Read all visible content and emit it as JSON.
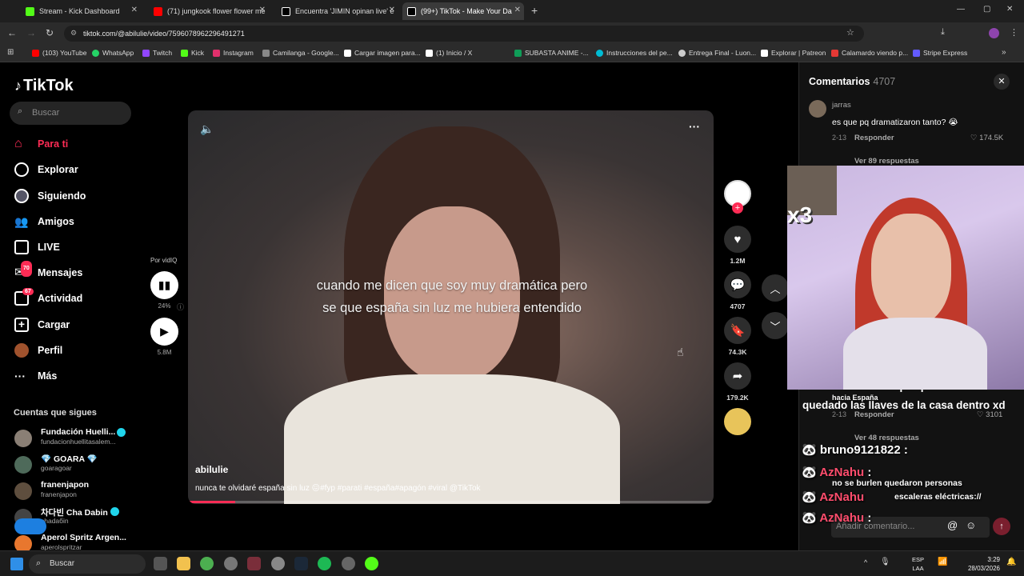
{
  "browser": {
    "tabs": [
      {
        "label": "Stream - Kick Dashboard",
        "color": "#53fc18"
      },
      {
        "label": "(71) jungkook flower flower me",
        "color": "#ff0000"
      },
      {
        "label": "Encuentra 'JIMIN opinan live' e",
        "color": "#ffffff"
      },
      {
        "label": "(99+) TikTok - Make Your Da",
        "color": "#ffffff"
      }
    ],
    "url": "tiktok.com/@abilulie/video/7596078962296491271",
    "bookmarks": [
      {
        "label": "(103) YouTube",
        "color": "#ff0000"
      },
      {
        "label": "WhatsApp",
        "color": "#25d366"
      },
      {
        "label": "Twitch",
        "color": "#9146ff"
      },
      {
        "label": "Kick",
        "color": "#53fc18"
      },
      {
        "label": "Instagram",
        "color": "#e1306c"
      },
      {
        "label": "Camilanga - Google...",
        "color": "#888888"
      },
      {
        "label": "Cargar imagen para...",
        "color": "#ffffff"
      },
      {
        "label": "(1) Inicio / X",
        "color": "#ffffff"
      },
      {
        "label": "SUBASTA ANIME -...",
        "color": "#0f9d58"
      },
      {
        "label": "Instrucciones del pe...",
        "color": "#00bcd4"
      },
      {
        "label": "Entrega Final - Luon...",
        "color": "#cccccc"
      },
      {
        "label": "Explorar | Patreon",
        "color": "#ffffff"
      },
      {
        "label": "Calamardo viendo p...",
        "color": "#e53935"
      },
      {
        "label": "Stripe Express",
        "color": "#635bff"
      }
    ]
  },
  "tiktok": {
    "logo": "TikTok",
    "search_placeholder": "Buscar",
    "nav": [
      {
        "label": "Para ti",
        "active": true
      },
      {
        "label": "Explorar"
      },
      {
        "label": "Siguiendo"
      },
      {
        "label": "Amigos"
      },
      {
        "label": "LIVE"
      },
      {
        "label": "Mensajes",
        "badge": "70"
      },
      {
        "label": "Actividad",
        "badge": "67"
      },
      {
        "label": "Cargar"
      },
      {
        "label": "Perfil"
      },
      {
        "label": "Más"
      }
    ],
    "following_heading": "Cuentas que sigues",
    "following": [
      {
        "name": "Fundación Huelli...",
        "handle": "fundacionhuellitasalem..."
      },
      {
        "name": "💎 GOARA 💎",
        "handle": "goaragoar"
      },
      {
        "name": "franenjapon",
        "handle": "franenjapon"
      },
      {
        "name": "차다빈 Cha Dabin",
        "handle": "chadaбin"
      },
      {
        "name": "Aperol Spritz Argen...",
        "handle": "aperolspritzar"
      }
    ],
    "vidiq": {
      "label": "Por vidIQ",
      "percent": "24%",
      "views": "5.8M"
    },
    "video": {
      "caption": "cuando me dicen que soy muy dramática pero se que españa sin luz me hubiera entendido",
      "user": "abilulie",
      "description": "nunca te olvidaré españa sin luz 😖#fyp #parati #españa#apagón #viral @TikTok",
      "progress": 0.09
    },
    "actions": {
      "likes": "1.2M",
      "comments": "4707",
      "saves": "74.3K",
      "shares": "179.2K"
    },
    "comments_panel": {
      "title": "Comentarios",
      "count": "4707",
      "first": {
        "user": "jarras",
        "text": "es que pq dramatizaron tanto? 😭",
        "date": "2-13",
        "reply": "Responder",
        "likes": "174.5K",
        "view_replies": "Ver 89 respuestas"
      },
      "second": {
        "text": "tenía como 6 años porque se habían quedado las llaves de la casa dentro xd",
        "date": "2-13",
        "reply": "Responder",
        "likes": "3101",
        "view_replies": "Ver 48 respuestas"
      },
      "add_placeholder": "Añadir comentario..."
    }
  },
  "stream_overlay": {
    "cam_label": "x3",
    "chat": [
      {
        "user": "bruno9121822",
        "text": ""
      },
      {
        "user": "AzNahu",
        "text": "no se burlen quedaron personas"
      },
      {
        "user": "AzNahu",
        "text": "escaleras eléctricas://"
      },
      {
        "user": "AzNahu",
        "text": ""
      }
    ],
    "chat_small": "hacia España"
  },
  "taskbar": {
    "search": "Buscar",
    "lang": "ESP",
    "lang_sub": "LAA",
    "time": "3:29",
    "date": "28/03/2026"
  }
}
